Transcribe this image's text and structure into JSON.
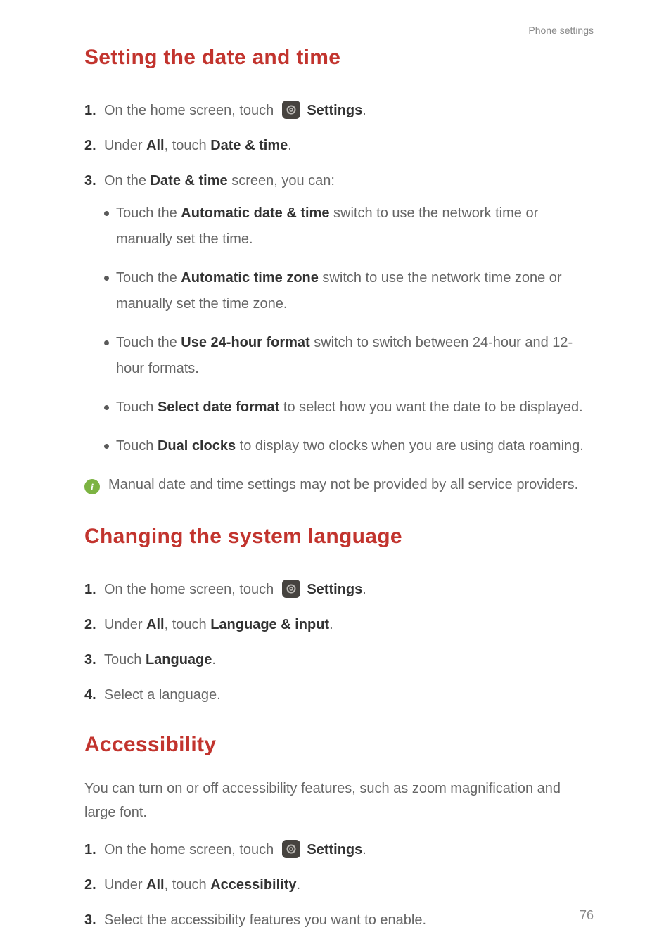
{
  "header": "Phone settings",
  "pageNumber": "76",
  "common": {
    "settingsLabel": "Settings",
    "allLabel": "All",
    "homeScreenPrefix": "On the home screen, touch ",
    "touchPrefix": "Touch ",
    "underPrefix": "Under "
  },
  "sec1": {
    "title": "Setting the date and time",
    "step2_menu": "Date & time",
    "step3_prefix": "On the ",
    "step3_bold": "Date & time",
    "step3_suffix": " screen, you can:",
    "b1_prefix": "Touch the ",
    "b1_bold": "Automatic date & time",
    "b1_suffix": " switch to use the network time or manually set the time.",
    "b2_prefix": "Touch the ",
    "b2_bold": "Automatic time zone",
    "b2_suffix": " switch to use the network time zone or manually set the time zone.",
    "b3_prefix": "Touch the ",
    "b3_bold": "Use 24-hour format",
    "b3_suffix": " switch to switch between 24-hour and 12-hour formats.",
    "b4_prefix": "Touch ",
    "b4_bold": "Select date format",
    "b4_suffix": " to select how you want the date to be displayed.",
    "b5_prefix": "Touch ",
    "b5_bold": "Dual clocks",
    "b5_suffix": " to display two clocks when you are using data roaming.",
    "note": "Manual date and time settings may not be provided by all service providers."
  },
  "sec2": {
    "title": "Changing the system language",
    "step2_menu": "Language & input",
    "step3_bold": "Language",
    "step4": "Select a language."
  },
  "sec3": {
    "title": "Accessibility",
    "intro": "You can turn on or off accessibility features, such as zoom magnification and large font.",
    "step2_menu": "Accessibility",
    "step3": "Select the accessibility features you want to enable."
  }
}
